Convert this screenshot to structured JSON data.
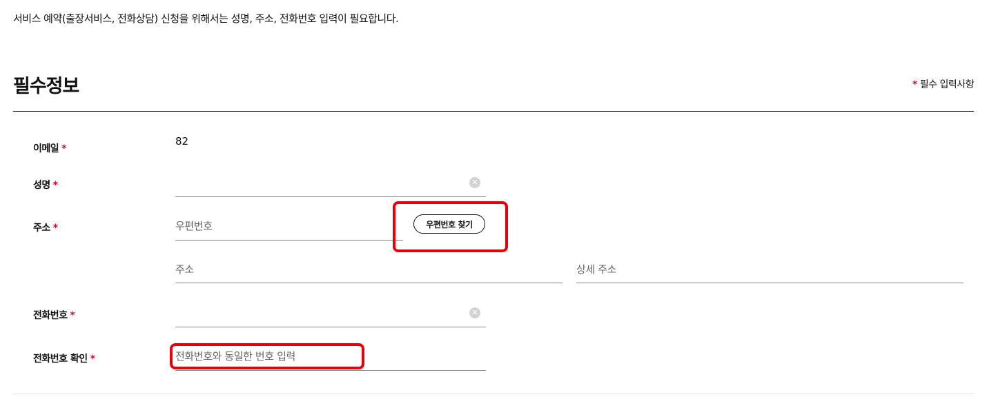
{
  "notice": "서비스 예약(출장서비스, 전화상담) 신청을 위해서는 성명, 주소, 전화번호 입력이 필요합니다.",
  "section": {
    "title": "필수정보",
    "required_mark": "*",
    "required_text": "필수 입력사항"
  },
  "form": {
    "email": {
      "label": "이메일",
      "value": "82"
    },
    "name": {
      "label": "성명",
      "value": "",
      "placeholder": ""
    },
    "address": {
      "label": "주소",
      "zip_placeholder": "우편번호",
      "zip_button": "우편번호 찾기",
      "address_placeholder": "주소",
      "detail_placeholder": "상세 주소"
    },
    "phone": {
      "label": "전화번호",
      "value": "",
      "placeholder": ""
    },
    "phone_confirm": {
      "label": "전화번호 확인",
      "placeholder": "전화번호와 동일한 번호 입력"
    }
  },
  "icons": {
    "clear": "clear-circle-icon"
  },
  "colors": {
    "required_star": "#c8102e",
    "highlight": "#e8000b"
  }
}
